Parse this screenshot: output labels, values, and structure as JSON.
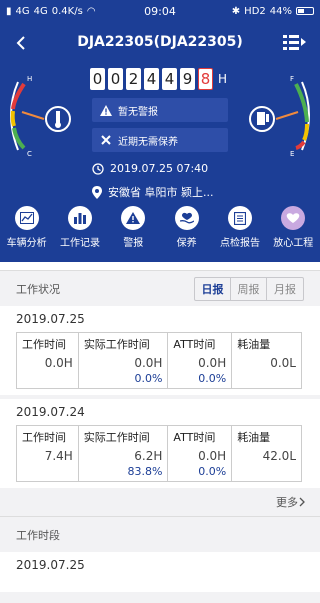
{
  "status_bar": {
    "left_signals": [
      "4G",
      "4G"
    ],
    "speed": "0.4K/s",
    "time": "09:04",
    "right": "HD2",
    "battery": "44%"
  },
  "header": {
    "title": "DJA22305(DJA22305)",
    "odometer": {
      "digits": [
        "0",
        "0",
        "2",
        "4",
        "4",
        "9"
      ],
      "decimal_digit": "8",
      "unit": "H"
    },
    "left_gauge": {
      "top_label": "H",
      "bottom_label": "C"
    },
    "right_gauge": {
      "top_label": "F",
      "bottom_label": "E"
    },
    "alarm_text": "暂无警报",
    "maintenance_text": "近期无需保养",
    "datetime": "2019.07.25 07:40",
    "location": "安徽省 阜阳市 颍上..."
  },
  "functions": [
    {
      "label": "车辆分析",
      "icon": "chart-icon"
    },
    {
      "label": "工作记录",
      "icon": "bar-chart-icon"
    },
    {
      "label": "警报",
      "icon": "warning-icon"
    },
    {
      "label": "保养",
      "icon": "care-icon"
    },
    {
      "label": "点检报告",
      "icon": "report-icon"
    },
    {
      "label": "放心工程",
      "icon": "heart-icon"
    }
  ],
  "work_status": {
    "title": "工作状况",
    "tabs": [
      "日报",
      "周报",
      "月报"
    ],
    "active_tab": "日报",
    "days": [
      {
        "date": "2019.07.25",
        "cells": [
          {
            "label": "工作时间",
            "value": "0.0H",
            "pct": ""
          },
          {
            "label": "实际工作时间",
            "value": "0.0H",
            "pct": "0.0%"
          },
          {
            "label": "ATT时间",
            "value": "0.0H",
            "pct": "0.0%"
          },
          {
            "label": "耗油量",
            "value": "0.0L",
            "pct": ""
          }
        ]
      },
      {
        "date": "2019.07.24",
        "cells": [
          {
            "label": "工作时间",
            "value": "7.4H",
            "pct": ""
          },
          {
            "label": "实际工作时间",
            "value": "6.2H",
            "pct": "83.8%"
          },
          {
            "label": "ATT时间",
            "value": "0.0H",
            "pct": "0.0%"
          },
          {
            "label": "耗油量",
            "value": "42.0L",
            "pct": ""
          }
        ]
      }
    ],
    "more": "更多"
  },
  "work_period": {
    "title": "工作时段",
    "date": "2019.07.25"
  },
  "colors": {
    "primary": "#1c3e96",
    "accent_red": "#e23b3b",
    "gauge_green": "#4caf50",
    "gauge_yellow": "#f2c200"
  }
}
